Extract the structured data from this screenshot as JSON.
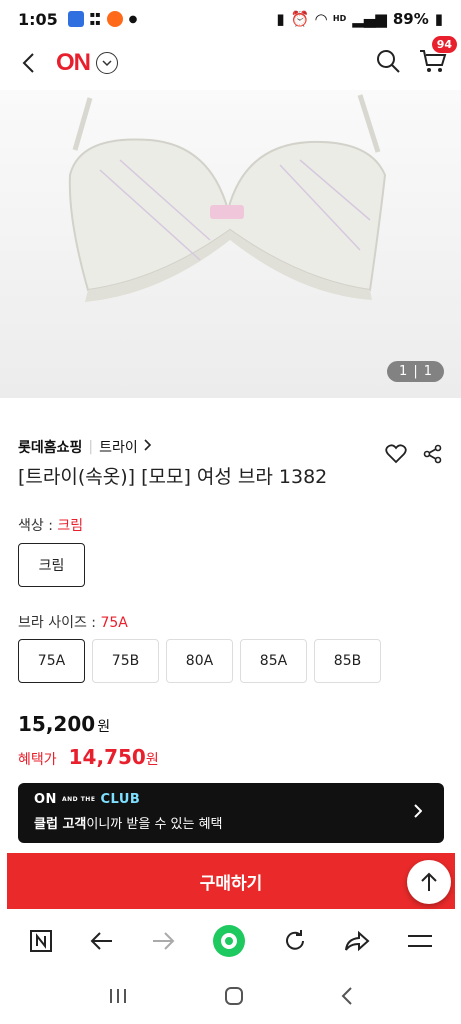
{
  "status": {
    "time": "1:05",
    "battery": "89%"
  },
  "header": {
    "logo": "ON",
    "cart_count": "94"
  },
  "gallery": {
    "current": "1",
    "total": "1"
  },
  "product": {
    "brand": "롯데홈쇼핑",
    "sub_brand": "트라이",
    "title": "[트라이(속옷)] [모모] 여성 브라 1382"
  },
  "color_option": {
    "label": "색상 : ",
    "selected": "크림",
    "options": [
      "크림"
    ]
  },
  "size_option": {
    "label": "브라 사이즈 : ",
    "selected": "75A",
    "options": [
      "75A",
      "75B",
      "80A",
      "85A",
      "85B"
    ]
  },
  "price": {
    "amount": "15,200",
    "unit": "원"
  },
  "benefit": {
    "label": "혜택가",
    "amount": "14,750",
    "unit": "원"
  },
  "club": {
    "logo_on": "ON",
    "logo_and_the": "AND THE",
    "logo_club": "CLUB",
    "text_bold": "클럽 고객",
    "text_rest": "이니까 받을 수 있는 혜택"
  },
  "buy_label": "구매하기",
  "colors": {
    "accent": "#e8202d",
    "buy": "#ea2a2a"
  }
}
